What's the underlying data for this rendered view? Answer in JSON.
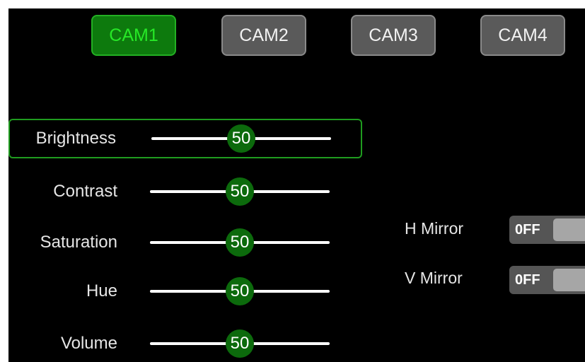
{
  "cam_tabs": [
    {
      "label": "CAM1",
      "active": true
    },
    {
      "label": "CAM2",
      "active": false
    },
    {
      "label": "CAM3",
      "active": false
    },
    {
      "label": "CAM4",
      "active": false
    }
  ],
  "settings": [
    {
      "label": "Brightness",
      "value": "50",
      "selected": true
    },
    {
      "label": "Contrast",
      "value": "50",
      "selected": false
    },
    {
      "label": "Saturation",
      "value": "50",
      "selected": false
    },
    {
      "label": "Hue",
      "value": "50",
      "selected": false
    },
    {
      "label": "Volume",
      "value": "50",
      "selected": false
    }
  ],
  "slider_range": {
    "min": 0,
    "max": 100
  },
  "mirrors": [
    {
      "label": "H Mirror",
      "state": "0FF"
    },
    {
      "label": "V Mirror",
      "state": "0FF"
    }
  ],
  "colors": {
    "background": "#000000",
    "accent_green": "#0c6a0c",
    "active_tab_text": "#27e827",
    "tab_gray": "#5a5a5a"
  }
}
